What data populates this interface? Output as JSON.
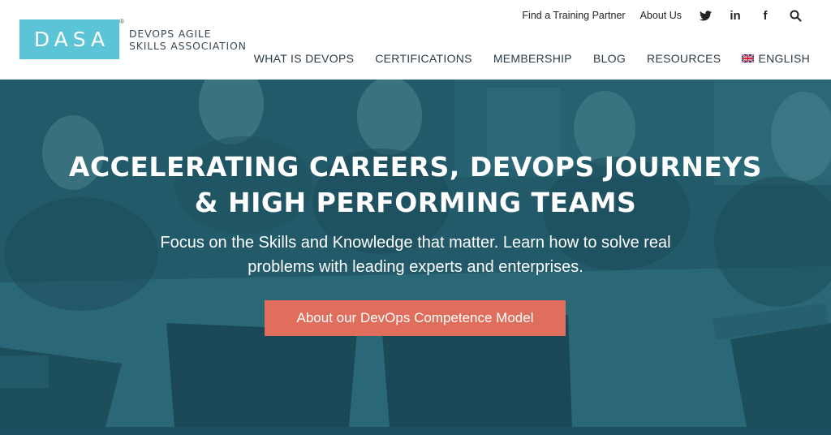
{
  "brand": {
    "logo_text": "DASA",
    "registered_mark": "®",
    "subtitle_line1": "DEVOPS AGILE",
    "subtitle_line2": "SKILLS ASSOCIATION",
    "color": "#5bc4d6"
  },
  "topbar": {
    "links": [
      "Find a Training Partner",
      "About Us"
    ],
    "icons": [
      "twitter-icon",
      "linkedin-icon",
      "facebook-icon",
      "search-icon"
    ],
    "linkedin_glyph": "in",
    "facebook_glyph": "f"
  },
  "nav": {
    "items": [
      "WHAT IS DEVOPS",
      "CERTIFICATIONS",
      "MEMBERSHIP",
      "BLOG",
      "RESOURCES"
    ],
    "language": "ENGLISH",
    "language_icon": "uk-flag-icon"
  },
  "hero": {
    "headline_line1": "ACCELERATING CAREERS, DEVOPS JOURNEYS",
    "headline_line2": "& HIGH PERFORMING TEAMS",
    "sub_line1": "Focus on the Skills and Knowledge that matter. Learn how to solve real",
    "sub_line2": "problems with leading experts and enterprises.",
    "cta_label": "About our DevOps Competence Model",
    "cta_color": "#e06e5c",
    "overlay_color": "#25606f"
  }
}
